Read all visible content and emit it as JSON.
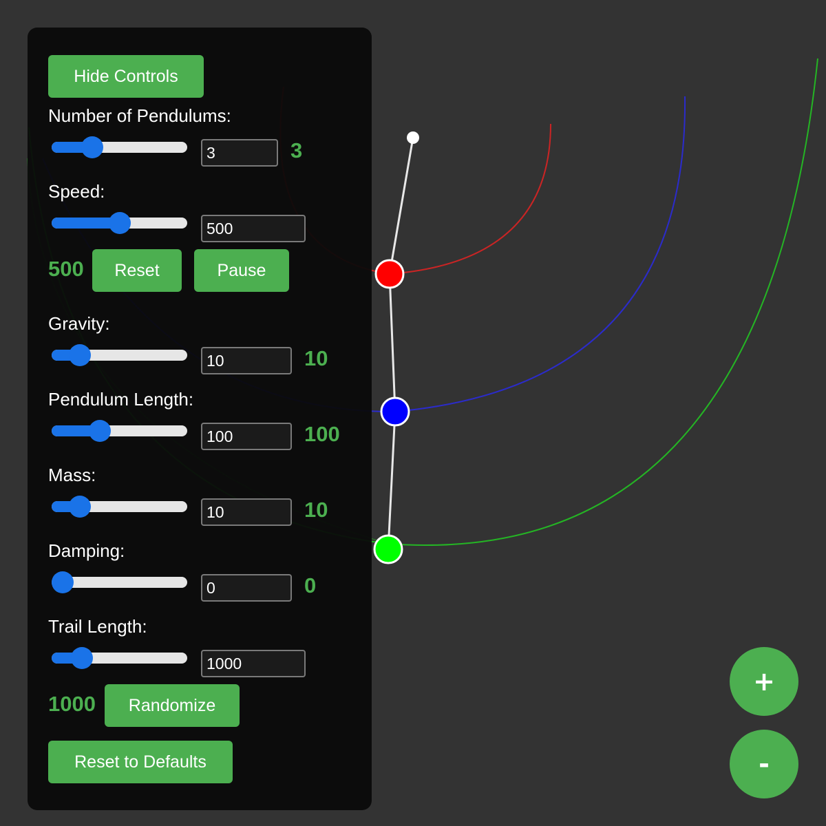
{
  "colors": {
    "background": "#333333",
    "panel": "#0a0a0a",
    "accent": "#4caf50",
    "slider": "#1a73e8",
    "bob1": "#ff0000",
    "bob2": "#0000ff",
    "bob3": "#00ff00"
  },
  "controls": {
    "hide_label": "Hide Controls",
    "pendulums": {
      "label": "Number of Pendulums:",
      "input": "3",
      "value": "3",
      "slider_fraction": 0.26
    },
    "speed": {
      "label": "Speed:",
      "input": "500",
      "value": "500",
      "slider_fraction": 0.5
    },
    "reset_label": "Reset",
    "pause_label": "Pause",
    "gravity": {
      "label": "Gravity:",
      "input": "10",
      "value": "10",
      "slider_fraction": 0.15
    },
    "length": {
      "label": "Pendulum Length:",
      "input": "100",
      "value": "100",
      "slider_fraction": 0.33
    },
    "mass": {
      "label": "Mass:",
      "input": "10",
      "value": "10",
      "slider_fraction": 0.15
    },
    "damping": {
      "label": "Damping:",
      "input": "0",
      "value": "0",
      "slider_fraction": 0.0
    },
    "trail": {
      "label": "Trail Length:",
      "input": "1000",
      "value": "1000",
      "slider_fraction": 0.17
    },
    "randomize_label": "Randomize",
    "defaults_label": "Reset to Defaults"
  },
  "zoom": {
    "in_label": "+",
    "out_label": "-"
  }
}
